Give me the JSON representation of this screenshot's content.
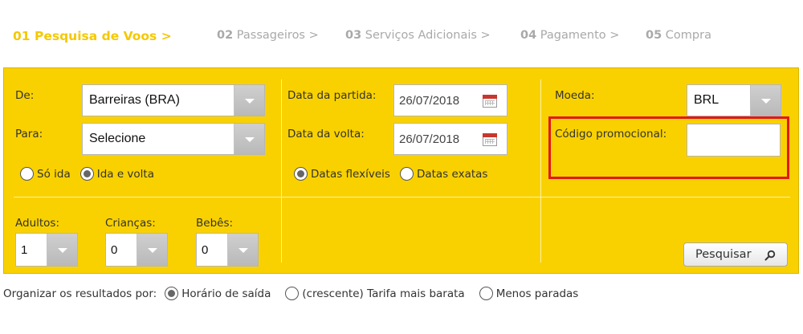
{
  "steps": [
    {
      "num": "01",
      "label": "Pesquisa de Voos",
      "arrow": ">",
      "active": true
    },
    {
      "num": "02",
      "label": "Passageiros",
      "arrow": ">",
      "active": false
    },
    {
      "num": "03",
      "label": "Serviços Adicionais",
      "arrow": ">",
      "active": false
    },
    {
      "num": "04",
      "label": "Pagamento",
      "arrow": ">",
      "active": false
    },
    {
      "num": "05",
      "label": "Compra",
      "arrow": "",
      "active": false
    }
  ],
  "search": {
    "from_label": "De:",
    "from_value": "Barreiras (BRA)",
    "to_label": "Para:",
    "to_value": "Selecione",
    "trip_one_way": "Só ida",
    "trip_round": "Ida e volta",
    "trip_selected": "round",
    "departure_label": "Data da partida:",
    "departure_value": "26/07/2018",
    "return_label": "Data da volta:",
    "return_value": "26/07/2018",
    "dates_flexible": "Datas flexíveis",
    "dates_exact": "Datas exatas",
    "dates_selected": "flexible",
    "currency_label": "Moeda:",
    "currency_value": "BRL",
    "promo_label": "Código promocional:",
    "promo_value": "",
    "adults_label": "Adultos:",
    "adults_value": "1",
    "children_label": "Crianças:",
    "children_value": "0",
    "infants_label": "Bebês:",
    "infants_value": "0",
    "search_button": "Pesquisar"
  },
  "sort": {
    "label": "Organizar os resultados por:",
    "options": [
      "Horário de saída",
      "(crescente) Tarifa mais barata",
      "Menos paradas"
    ],
    "selected_index": 0
  },
  "colors": {
    "accent": "#f9d100",
    "active_step": "#f5c800",
    "highlight": "#e3171b"
  }
}
